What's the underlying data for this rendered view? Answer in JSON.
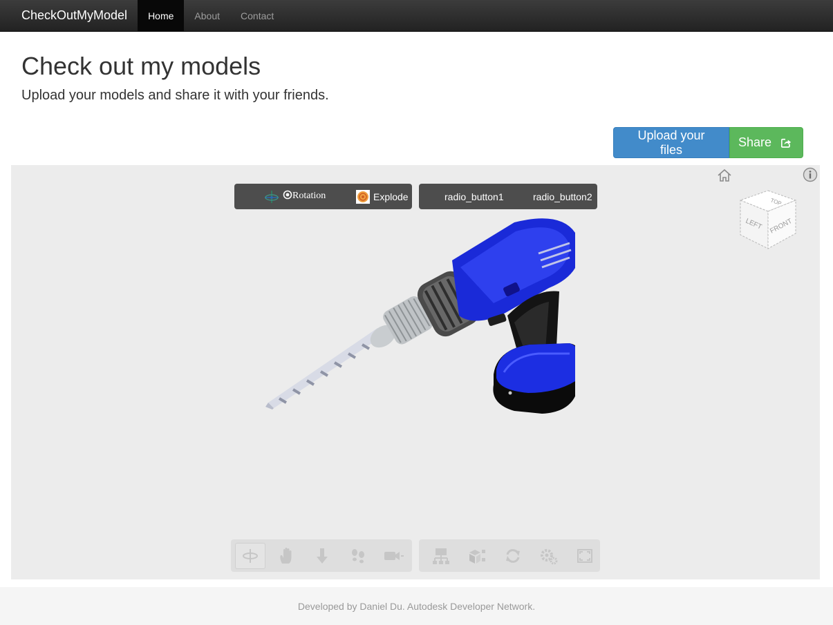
{
  "navbar": {
    "brand": "CheckOutMyModel",
    "links": [
      {
        "label": "Home",
        "active": true
      },
      {
        "label": "About",
        "active": false
      },
      {
        "label": "Contact",
        "active": false
      }
    ]
  },
  "header": {
    "title": "Check out my models",
    "lead": "Upload your models and share it with your friends."
  },
  "actions": {
    "upload_label": "Upload your files",
    "share_label": "Share",
    "upload_color": "#428bca",
    "share_color": "#5cb85c"
  },
  "viewer": {
    "toolbar_left": {
      "rotation_label": "Rotation",
      "explode_label": "Explode"
    },
    "toolbar_right": {
      "radio1_label": "radio_button1",
      "radio2_label": "radio_button2"
    },
    "viewcube": {
      "top": "TOP",
      "left": "LEFT",
      "front": "FRONT"
    },
    "bottom_tools_left": [
      "orbit-icon",
      "pan-icon",
      "zoom-icon",
      "walk-icon",
      "camera-icon"
    ],
    "bottom_tools_right": [
      "model-browser-icon",
      "explode-model-icon",
      "reset-view-icon",
      "settings-icon",
      "fullscreen-icon"
    ]
  },
  "footer": {
    "text": "Developed by Daniel Du. Autodesk Developer Network."
  }
}
